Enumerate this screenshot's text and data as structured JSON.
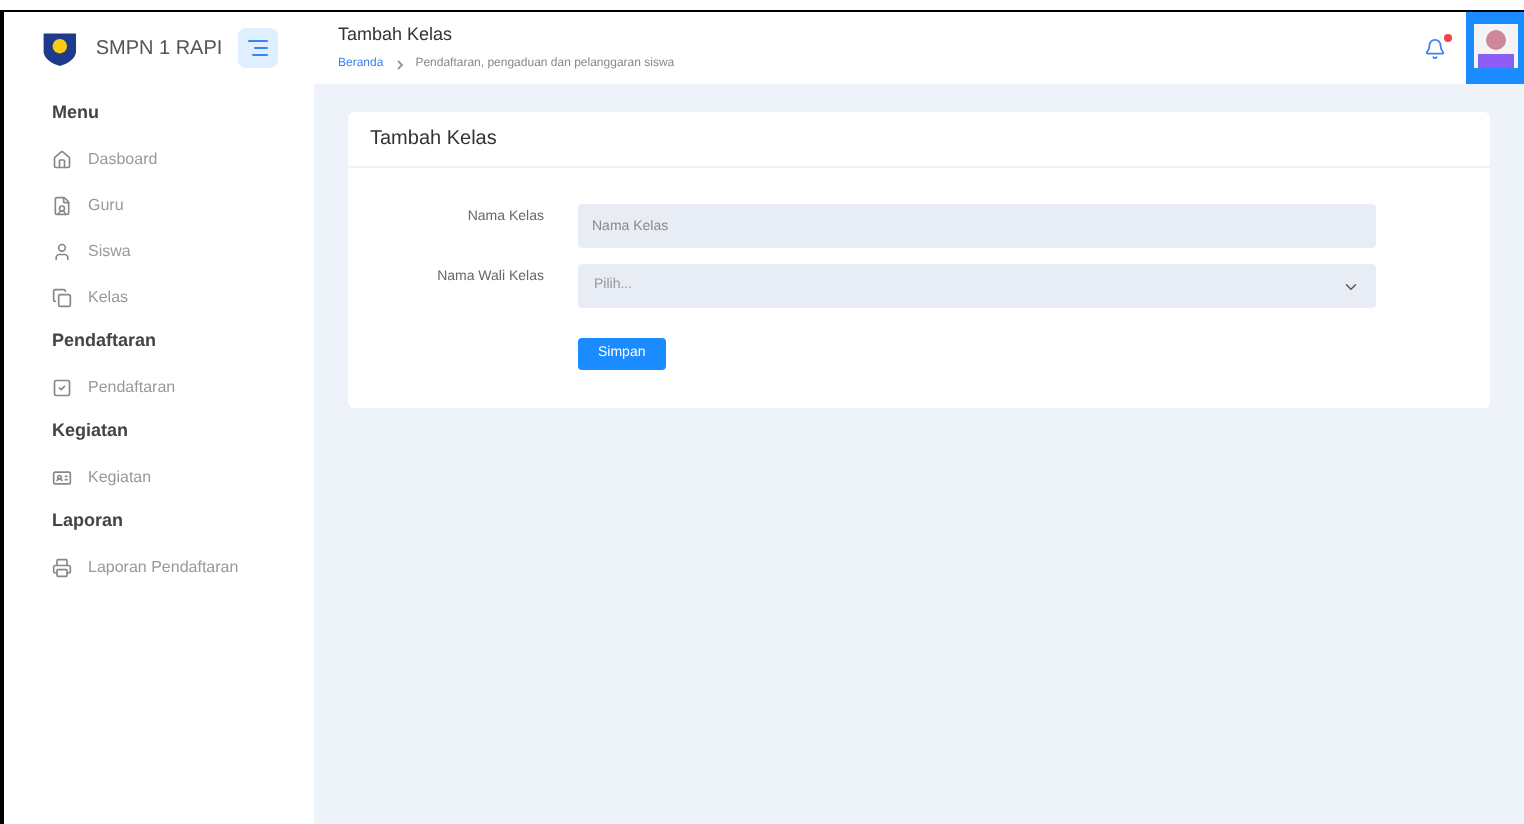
{
  "sidebar": {
    "brand": "SMPN 1 RAPI",
    "sections": [
      {
        "title": "Menu",
        "items": [
          {
            "label": "Dasboard",
            "kind": "home"
          },
          {
            "label": "Guru",
            "kind": "guru"
          },
          {
            "label": "Siswa",
            "kind": "user"
          },
          {
            "label": "Kelas",
            "kind": "kelas"
          }
        ]
      },
      {
        "title": "Pendaftaran",
        "items": [
          {
            "label": "Pendaftaran",
            "kind": "check"
          }
        ]
      },
      {
        "title": "Kegiatan",
        "items": [
          {
            "label": "Kegiatan",
            "kind": "card"
          }
        ]
      },
      {
        "title": "Laporan",
        "items": [
          {
            "label": "Laporan Pendaftaran",
            "kind": "print"
          }
        ]
      }
    ]
  },
  "header": {
    "title": "Tambah Kelas",
    "breadcrumb": [
      "Beranda",
      "Pendaftaran, pengaduan dan pelanggaran siswa"
    ],
    "notification": true
  },
  "card": {
    "title": "Tambah Kelas",
    "fields": [
      {
        "label": "Nama Kelas",
        "kind": "text",
        "placeholder": "Nama Kelas"
      },
      {
        "label": "Nama Wali Kelas",
        "kind": "select",
        "placeholder": "Pilih..."
      }
    ],
    "button": "Simpan"
  }
}
